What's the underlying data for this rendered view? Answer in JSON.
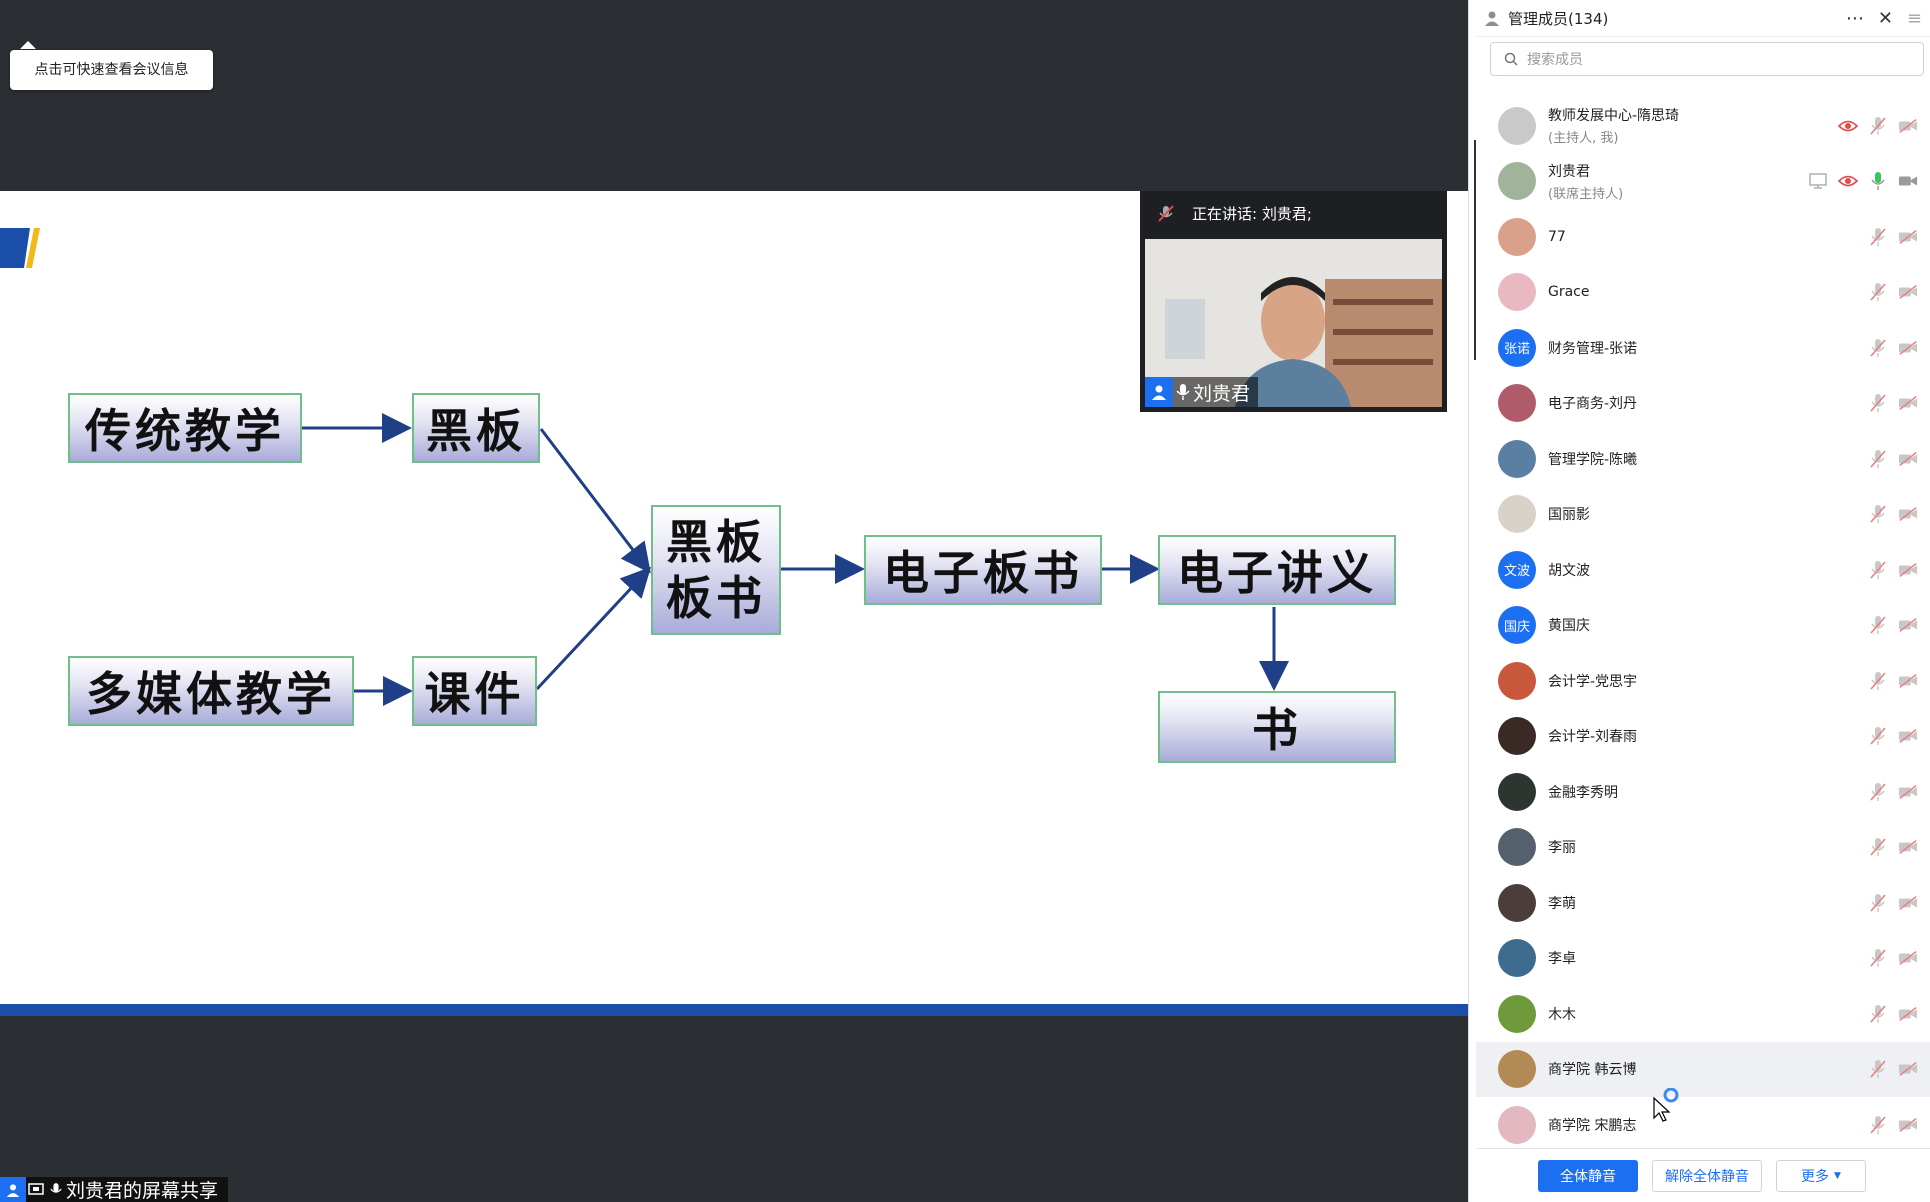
{
  "tooltip": "点击可快速查看会议信息",
  "slide": {
    "nodes": {
      "traditional": "传统教学",
      "blackboard": "黑板",
      "multimedia": "多媒体教学",
      "courseware": "课件",
      "bb_line1": "黑板",
      "bb_line2": "板书",
      "e_board": "电子板书",
      "e_notes": "电子讲义",
      "book": "书"
    }
  },
  "speaker": {
    "status": "正在讲话: 刘贵君;",
    "name": "刘贵君"
  },
  "share_label": "刘贵君的屏幕共享",
  "panel": {
    "title": "管理成员(134)",
    "search_placeholder": "搜索成员",
    "members": [
      {
        "name": "教师发展中心-隋思琦",
        "sub": "(主持人, 我)",
        "avatar": "",
        "color": "#c9c9c9",
        "icons": [
          "eye",
          "mic-off",
          "cam-off"
        ]
      },
      {
        "name": "刘贵君",
        "sub": "(联席主持人)",
        "avatar": "",
        "color": "#9fb49a",
        "icons": [
          "screen",
          "eye",
          "mic-on",
          "cam-on"
        ]
      },
      {
        "name": "77",
        "sub": "",
        "avatar": "",
        "color": "#d9a08a",
        "icons": [
          "mic-off",
          "cam-off"
        ]
      },
      {
        "name": "Grace",
        "sub": "",
        "avatar": "",
        "color": "#e8b9c1",
        "icons": [
          "mic-off",
          "cam-off"
        ]
      },
      {
        "name": "财务管理-张诺",
        "sub": "",
        "avatar": "张诺",
        "color": "#1d6ff2",
        "icons": [
          "mic-off",
          "cam-off"
        ]
      },
      {
        "name": "电子商务-刘丹",
        "sub": "",
        "avatar": "",
        "color": "#b05b6a",
        "icons": [
          "mic-off",
          "cam-off"
        ]
      },
      {
        "name": "管理学院-陈曦",
        "sub": "",
        "avatar": "",
        "color": "#5a7fa3",
        "icons": [
          "mic-off",
          "cam-off"
        ]
      },
      {
        "name": "国丽影",
        "sub": "",
        "avatar": "",
        "color": "#d8d2c8",
        "icons": [
          "mic-off",
          "cam-off"
        ]
      },
      {
        "name": "胡文波",
        "sub": "",
        "avatar": "文波",
        "color": "#1d6ff2",
        "icons": [
          "mic-off",
          "cam-off"
        ]
      },
      {
        "name": "黄国庆",
        "sub": "",
        "avatar": "国庆",
        "color": "#1d6ff2",
        "icons": [
          "mic-off",
          "cam-off"
        ]
      },
      {
        "name": "会计学-党思宇",
        "sub": "",
        "avatar": "",
        "color": "#c9573b",
        "icons": [
          "mic-off",
          "cam-off"
        ]
      },
      {
        "name": "会计学-刘春雨",
        "sub": "",
        "avatar": "",
        "color": "#3a2a25",
        "icons": [
          "mic-off",
          "cam-off"
        ]
      },
      {
        "name": "金融李秀明",
        "sub": "",
        "avatar": "",
        "color": "#2e3530",
        "icons": [
          "mic-off",
          "cam-off"
        ]
      },
      {
        "name": "李丽",
        "sub": "",
        "avatar": "",
        "color": "#54606b",
        "icons": [
          "mic-off",
          "cam-off"
        ]
      },
      {
        "name": "李萌",
        "sub": "",
        "avatar": "",
        "color": "#4b3d3a",
        "icons": [
          "mic-off",
          "cam-off"
        ]
      },
      {
        "name": "李卓",
        "sub": "",
        "avatar": "",
        "color": "#3d6c8f",
        "icons": [
          "mic-off",
          "cam-off"
        ]
      },
      {
        "name": "木木",
        "sub": "",
        "avatar": "",
        "color": "#6f9a3c",
        "icons": [
          "mic-off",
          "cam-off"
        ]
      },
      {
        "name": "商学院 韩云博",
        "sub": "",
        "avatar": "",
        "color": "#b38a55",
        "icons": [
          "mic-off",
          "cam-off"
        ]
      },
      {
        "name": "商学院 宋鹏志",
        "sub": "",
        "avatar": "",
        "color": "#e3b8c0",
        "icons": [
          "mic-off",
          "cam-off"
        ]
      }
    ],
    "buttons": {
      "mute_all": "全体静音",
      "unmute_all": "解除全体静音",
      "more": "更多"
    }
  }
}
